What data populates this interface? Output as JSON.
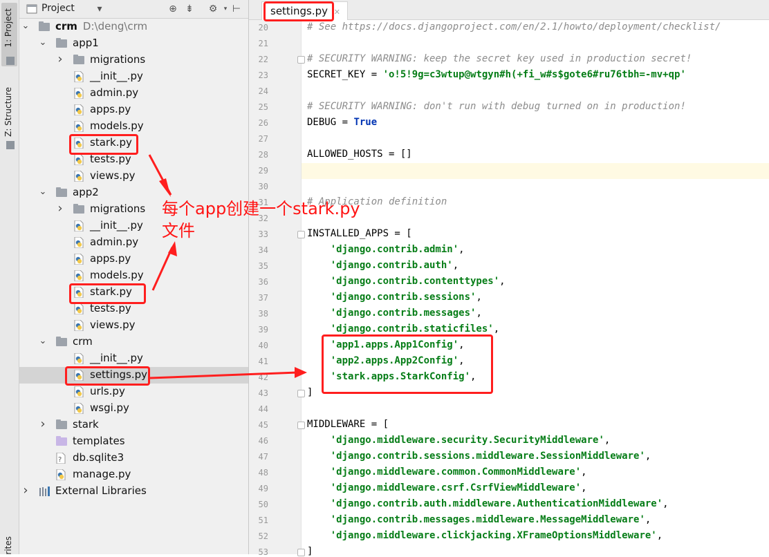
{
  "side_strip": {
    "project_label": "1: Project",
    "structure_label": "Z: Structure",
    "favorites_label": "rites"
  },
  "project_panel": {
    "title": "Project",
    "icons": [
      "project-view-icon",
      "dropdown-icon",
      "locate-icon",
      "collapse-icon",
      "gear-icon",
      "hide-icon"
    ],
    "tree": [
      {
        "label": "crm",
        "path": "D:\\deng\\crm",
        "icon": "folder-icon",
        "expanded": true
      },
      {
        "label": "app1",
        "icon": "folder-icon",
        "expanded": true
      },
      {
        "label": "migrations",
        "icon": "folder-icon",
        "expanded": false
      },
      {
        "label": "__init__.py",
        "icon": "python-file-icon"
      },
      {
        "label": "admin.py",
        "icon": "python-file-icon"
      },
      {
        "label": "apps.py",
        "icon": "python-file-icon"
      },
      {
        "label": "models.py",
        "icon": "python-file-icon"
      },
      {
        "label": "stark.py",
        "icon": "python-file-icon"
      },
      {
        "label": "tests.py",
        "icon": "python-file-icon"
      },
      {
        "label": "views.py",
        "icon": "python-file-icon"
      },
      {
        "label": "app2",
        "icon": "folder-icon",
        "expanded": true
      },
      {
        "label": "migrations",
        "icon": "folder-icon",
        "expanded": false
      },
      {
        "label": "__init__.py",
        "icon": "python-file-icon"
      },
      {
        "label": "admin.py",
        "icon": "python-file-icon"
      },
      {
        "label": "apps.py",
        "icon": "python-file-icon"
      },
      {
        "label": "models.py",
        "icon": "python-file-icon"
      },
      {
        "label": "stark.py",
        "icon": "python-file-icon"
      },
      {
        "label": "tests.py",
        "icon": "python-file-icon"
      },
      {
        "label": "views.py",
        "icon": "python-file-icon"
      },
      {
        "label": "crm",
        "icon": "folder-icon",
        "expanded": true
      },
      {
        "label": "__init__.py",
        "icon": "python-file-icon"
      },
      {
        "label": "settings.py",
        "icon": "python-file-icon",
        "selected": true
      },
      {
        "label": "urls.py",
        "icon": "python-file-icon"
      },
      {
        "label": "wsgi.py",
        "icon": "python-file-icon"
      },
      {
        "label": "stark",
        "icon": "folder-icon",
        "expanded": false
      },
      {
        "label": "templates",
        "icon": "templates-folder-icon"
      },
      {
        "label": "db.sqlite3",
        "icon": "database-file-icon"
      },
      {
        "label": "manage.py",
        "icon": "python-file-icon"
      },
      {
        "label": "External Libraries",
        "icon": "libraries-icon",
        "expanded": false
      }
    ]
  },
  "editor": {
    "tab_label": "settings.py",
    "lines": [
      {
        "n": "20",
        "segs": [
          {
            "t": "# See https://docs.djangoproject.com/en/2.1/howto/deployment/checklist/",
            "c": "cmt"
          }
        ]
      },
      {
        "n": "21",
        "segs": []
      },
      {
        "n": "22",
        "segs": [
          {
            "t": "# SECURITY WARNING: keep the secret key used in production secret!",
            "c": "cmt"
          }
        ]
      },
      {
        "n": "23",
        "segs": [
          {
            "t": "SECRET_KEY = ",
            "c": "plain"
          },
          {
            "t": "'o!5!9g=c3wtup@wtgyn#h(+fi_w#s$gote6#ru76tbh=-mv+qp'",
            "c": "str"
          }
        ]
      },
      {
        "n": "24",
        "segs": []
      },
      {
        "n": "25",
        "segs": [
          {
            "t": "# SECURITY WARNING: don't run with debug turned on in production!",
            "c": "cmt"
          }
        ]
      },
      {
        "n": "26",
        "segs": [
          {
            "t": "DEBUG = ",
            "c": "plain"
          },
          {
            "t": "True",
            "c": "kw"
          }
        ]
      },
      {
        "n": "27",
        "segs": []
      },
      {
        "n": "28",
        "segs": [
          {
            "t": "ALLOWED_HOSTS = []",
            "c": "plain"
          }
        ]
      },
      {
        "n": "29",
        "segs": []
      },
      {
        "n": "30",
        "segs": []
      },
      {
        "n": "31",
        "segs": [
          {
            "t": "# Application definition",
            "c": "cmt"
          }
        ]
      },
      {
        "n": "32",
        "segs": []
      },
      {
        "n": "33",
        "segs": [
          {
            "t": "INSTALLED_APPS = [",
            "c": "plain"
          }
        ]
      },
      {
        "n": "34",
        "segs": [
          {
            "t": "    ",
            "c": "plain"
          },
          {
            "t": "'django.contrib.admin'",
            "c": "str"
          },
          {
            "t": ",",
            "c": "plain"
          }
        ]
      },
      {
        "n": "35",
        "segs": [
          {
            "t": "    ",
            "c": "plain"
          },
          {
            "t": "'django.contrib.auth'",
            "c": "str"
          },
          {
            "t": ",",
            "c": "plain"
          }
        ]
      },
      {
        "n": "36",
        "segs": [
          {
            "t": "    ",
            "c": "plain"
          },
          {
            "t": "'django.contrib.contenttypes'",
            "c": "str"
          },
          {
            "t": ",",
            "c": "plain"
          }
        ]
      },
      {
        "n": "37",
        "segs": [
          {
            "t": "    ",
            "c": "plain"
          },
          {
            "t": "'django.contrib.sessions'",
            "c": "str"
          },
          {
            "t": ",",
            "c": "plain"
          }
        ]
      },
      {
        "n": "38",
        "segs": [
          {
            "t": "    ",
            "c": "plain"
          },
          {
            "t": "'django.contrib.messages'",
            "c": "str"
          },
          {
            "t": ",",
            "c": "plain"
          }
        ]
      },
      {
        "n": "39",
        "segs": [
          {
            "t": "    ",
            "c": "plain"
          },
          {
            "t": "'django.contrib.staticfiles'",
            "c": "str"
          },
          {
            "t": ",",
            "c": "plain"
          }
        ]
      },
      {
        "n": "40",
        "segs": [
          {
            "t": "    ",
            "c": "plain"
          },
          {
            "t": "'app1.apps.App1Config'",
            "c": "str"
          },
          {
            "t": ",",
            "c": "plain"
          }
        ]
      },
      {
        "n": "41",
        "segs": [
          {
            "t": "    ",
            "c": "plain"
          },
          {
            "t": "'app2.apps.App2Config'",
            "c": "str"
          },
          {
            "t": ",",
            "c": "plain"
          }
        ]
      },
      {
        "n": "42",
        "segs": [
          {
            "t": "    ",
            "c": "plain"
          },
          {
            "t": "'stark.apps.StarkConfig'",
            "c": "str"
          },
          {
            "t": ",",
            "c": "plain"
          }
        ]
      },
      {
        "n": "43",
        "segs": [
          {
            "t": "]",
            "c": "plain"
          }
        ]
      },
      {
        "n": "44",
        "segs": []
      },
      {
        "n": "45",
        "segs": [
          {
            "t": "MIDDLEWARE = [",
            "c": "plain"
          }
        ]
      },
      {
        "n": "46",
        "segs": [
          {
            "t": "    ",
            "c": "plain"
          },
          {
            "t": "'django.middleware.security.SecurityMiddleware'",
            "c": "str"
          },
          {
            "t": ",",
            "c": "plain"
          }
        ]
      },
      {
        "n": "47",
        "segs": [
          {
            "t": "    ",
            "c": "plain"
          },
          {
            "t": "'django.contrib.sessions.middleware.SessionMiddleware'",
            "c": "str"
          },
          {
            "t": ",",
            "c": "plain"
          }
        ]
      },
      {
        "n": "48",
        "segs": [
          {
            "t": "    ",
            "c": "plain"
          },
          {
            "t": "'django.middleware.common.CommonMiddleware'",
            "c": "str"
          },
          {
            "t": ",",
            "c": "plain"
          }
        ]
      },
      {
        "n": "49",
        "segs": [
          {
            "t": "    ",
            "c": "plain"
          },
          {
            "t": "'django.middleware.csrf.CsrfViewMiddleware'",
            "c": "str"
          },
          {
            "t": ",",
            "c": "plain"
          }
        ]
      },
      {
        "n": "50",
        "segs": [
          {
            "t": "    ",
            "c": "plain"
          },
          {
            "t": "'django.contrib.auth.middleware.AuthenticationMiddleware'",
            "c": "str"
          },
          {
            "t": ",",
            "c": "plain"
          }
        ]
      },
      {
        "n": "51",
        "segs": [
          {
            "t": "    ",
            "c": "plain"
          },
          {
            "t": "'django.contrib.messages.middleware.MessageMiddleware'",
            "c": "str"
          },
          {
            "t": ",",
            "c": "plain"
          }
        ]
      },
      {
        "n": "52",
        "segs": [
          {
            "t": "    ",
            "c": "plain"
          },
          {
            "t": "'django.middleware.clickjacking.XFrameOptionsMiddleware'",
            "c": "str"
          },
          {
            "t": ",",
            "c": "plain"
          }
        ]
      },
      {
        "n": "53",
        "segs": [
          {
            "t": "]",
            "c": "plain"
          }
        ]
      }
    ],
    "current_line": "29"
  },
  "annotation": {
    "line1": "每个app创建一个stark.py",
    "line2": "文件"
  },
  "colors": {
    "annotation_red": "#ff1e1e",
    "string_green": "#067d17",
    "keyword_blue": "#0033b3",
    "comment_gray": "#8c8c8c"
  }
}
